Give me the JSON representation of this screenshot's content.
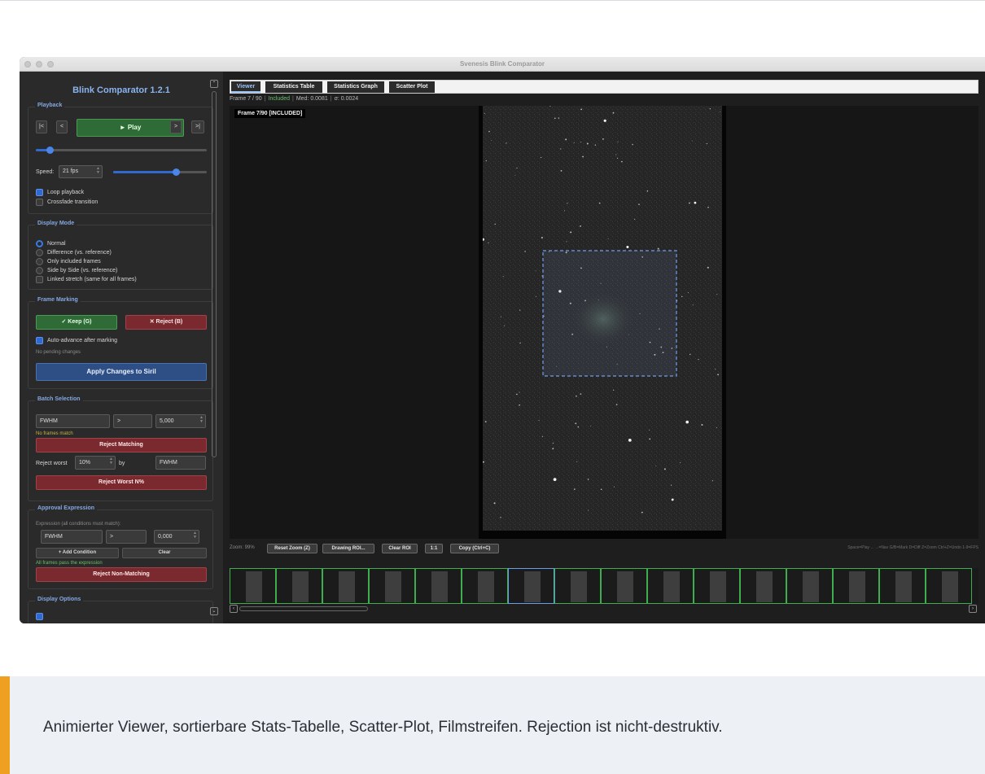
{
  "window": {
    "title": "Svenesis Blink Comparator"
  },
  "sidebar": {
    "app_title": "Blink Comparator 1.2.1",
    "playback": {
      "title": "Playback",
      "first_label": "|<",
      "prev_label": "<",
      "play_label": "► Play",
      "next_label": ">",
      "last_label": ">|",
      "position_fraction": 0.08,
      "speed_label": "Speed:",
      "speed_value": "21 fps",
      "speed_fraction": 0.67,
      "loop_label": "Loop playback",
      "loop_checked": true,
      "crossfade_label": "Crossfade transition",
      "crossfade_checked": false
    },
    "display_mode": {
      "title": "Display Mode",
      "options": [
        "Normal",
        "Difference (vs. reference)",
        "Only included frames",
        "Side by Side (vs. reference)",
        "Linked stretch (same for all frames)"
      ],
      "selected": "Normal"
    },
    "frame_marking": {
      "title": "Frame Marking",
      "keep_label": "✓  Keep  (G)",
      "reject_label": "✕  Reject  (B)",
      "auto_advance_label": "Auto-advance after marking",
      "auto_advance_checked": true,
      "pending_text": "No pending changes",
      "apply_label": "Apply Changes to Siril"
    },
    "batch_selection": {
      "title": "Batch Selection",
      "metric": "FWHM",
      "operator": ">",
      "value": "5,000",
      "match_status": "No frames match",
      "reject_matching_label": "Reject Matching",
      "reject_worst_label": "Reject worst",
      "worst_percent": "10%",
      "by_label": "by",
      "worst_metric": "FWHM",
      "reject_worst_button": "Reject Worst N%"
    },
    "approval_expression": {
      "title": "Approval Expression",
      "hint": "Expression (all conditions must match):",
      "metric": "FWHM",
      "operator": ">",
      "value": "0,000",
      "add_condition_label": "+ Add Condition",
      "clear_label": "Clear",
      "status": "All frames pass the expression",
      "reject_non_matching_label": "Reject Non-Matching"
    },
    "display_options": {
      "title": "Display Options"
    }
  },
  "main": {
    "tabs": [
      {
        "label": "Viewer",
        "active": true
      },
      {
        "label": "Statistics Table",
        "active": false
      },
      {
        "label": "Statistics Graph",
        "active": false
      },
      {
        "label": "Scatter Plot",
        "active": false
      }
    ],
    "status": {
      "frame": "Frame 7 / 90",
      "state": "Included",
      "median": "Med: 0.0081",
      "sigma": "σ: 0.0024"
    },
    "viewer": {
      "frame_label": "Frame 7/90  [INCLUDED]"
    },
    "toolbar": {
      "zoom": "Zoom: 99%",
      "reset_zoom": "Reset Zoom (Z)",
      "drawing_roi": "Drawing ROI...",
      "clear_roi": "Clear ROI",
      "one_to_one": "1:1",
      "copy": "Copy (Ctrl+C)",
      "shortcuts": "Space=Play  ←→=Nav  G/B=Mark  D=Diff  Z=Zoom  Ctrl+Z=Undo  1-9=FPS"
    },
    "filmstrip": {
      "thumb_count": 16,
      "current_index": 6
    }
  },
  "caption": {
    "text": "Animierter Viewer, sortierbare Stats-Tabelle, Scatter-Plot, Filmstreifen. Rejection ist nicht-destruktiv.",
    "accent_color": "#f0a020"
  },
  "colors": {
    "accent_blue": "#84a8e0",
    "keep_green": "#2f6b36",
    "reject_red": "#7a2a2e",
    "apply_blue": "#2d4f86",
    "included_green": "#6abf69"
  }
}
